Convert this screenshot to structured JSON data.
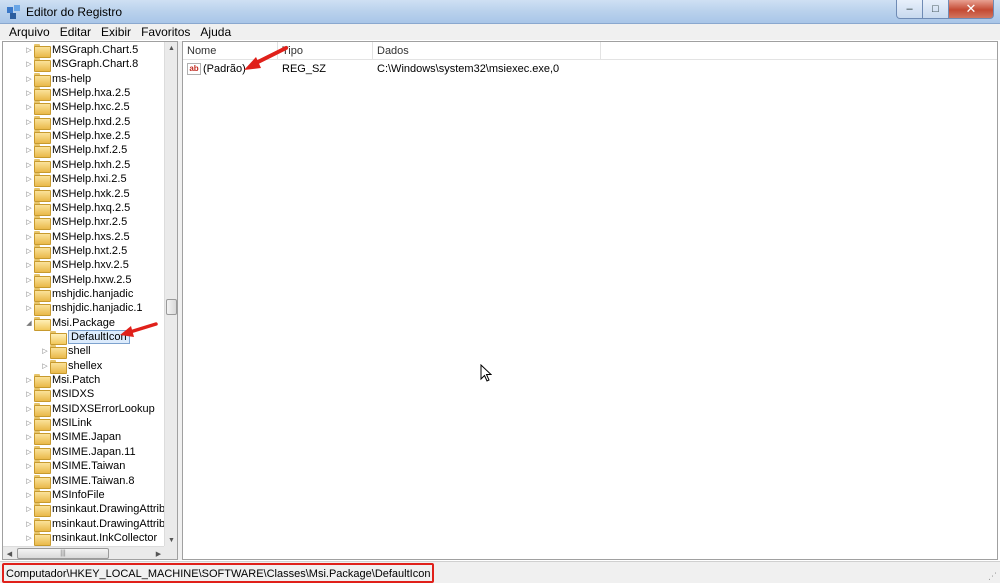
{
  "window": {
    "title": "Editor do Registro",
    "minimize_glyph": "–",
    "maximize_glyph": "□",
    "close_glyph": "✕"
  },
  "menu": [
    "Arquivo",
    "Editar",
    "Exibir",
    "Favoritos",
    "Ajuda"
  ],
  "tree": {
    "items": [
      {
        "label": "MSGraph.Chart.5",
        "level": 0,
        "expander": "collapsed"
      },
      {
        "label": "MSGraph.Chart.8",
        "level": 0,
        "expander": "collapsed"
      },
      {
        "label": "ms-help",
        "level": 0,
        "expander": "collapsed"
      },
      {
        "label": "MSHelp.hxa.2.5",
        "level": 0,
        "expander": "collapsed"
      },
      {
        "label": "MSHelp.hxc.2.5",
        "level": 0,
        "expander": "collapsed"
      },
      {
        "label": "MSHelp.hxd.2.5",
        "level": 0,
        "expander": "collapsed"
      },
      {
        "label": "MSHelp.hxe.2.5",
        "level": 0,
        "expander": "collapsed"
      },
      {
        "label": "MSHelp.hxf.2.5",
        "level": 0,
        "expander": "collapsed"
      },
      {
        "label": "MSHelp.hxh.2.5",
        "level": 0,
        "expander": "collapsed"
      },
      {
        "label": "MSHelp.hxi.2.5",
        "level": 0,
        "expander": "collapsed"
      },
      {
        "label": "MSHelp.hxk.2.5",
        "level": 0,
        "expander": "collapsed"
      },
      {
        "label": "MSHelp.hxq.2.5",
        "level": 0,
        "expander": "collapsed"
      },
      {
        "label": "MSHelp.hxr.2.5",
        "level": 0,
        "expander": "collapsed"
      },
      {
        "label": "MSHelp.hxs.2.5",
        "level": 0,
        "expander": "collapsed"
      },
      {
        "label": "MSHelp.hxt.2.5",
        "level": 0,
        "expander": "collapsed"
      },
      {
        "label": "MSHelp.hxv.2.5",
        "level": 0,
        "expander": "collapsed"
      },
      {
        "label": "MSHelp.hxw.2.5",
        "level": 0,
        "expander": "collapsed"
      },
      {
        "label": "mshjdic.hanjadic",
        "level": 0,
        "expander": "collapsed"
      },
      {
        "label": "mshjdic.hanjadic.1",
        "level": 0,
        "expander": "collapsed"
      },
      {
        "label": "Msi.Package",
        "level": 0,
        "expander": "expanded"
      },
      {
        "label": "DefaultIcon",
        "level": 1,
        "expander": "none",
        "selected": true
      },
      {
        "label": "shell",
        "level": 1,
        "expander": "collapsed"
      },
      {
        "label": "shellex",
        "level": 1,
        "expander": "collapsed"
      },
      {
        "label": "Msi.Patch",
        "level": 0,
        "expander": "collapsed"
      },
      {
        "label": "MSIDXS",
        "level": 0,
        "expander": "collapsed"
      },
      {
        "label": "MSIDXSErrorLookup",
        "level": 0,
        "expander": "collapsed"
      },
      {
        "label": "MSILink",
        "level": 0,
        "expander": "collapsed"
      },
      {
        "label": "MSIME.Japan",
        "level": 0,
        "expander": "collapsed"
      },
      {
        "label": "MSIME.Japan.11",
        "level": 0,
        "expander": "collapsed"
      },
      {
        "label": "MSIME.Taiwan",
        "level": 0,
        "expander": "collapsed"
      },
      {
        "label": "MSIME.Taiwan.8",
        "level": 0,
        "expander": "collapsed"
      },
      {
        "label": "MSInfoFile",
        "level": 0,
        "expander": "collapsed"
      },
      {
        "label": "msinkaut.DrawingAttribut",
        "level": 0,
        "expander": "collapsed"
      },
      {
        "label": "msinkaut.DrawingAttribut",
        "level": 0,
        "expander": "collapsed"
      },
      {
        "label": "msinkaut.InkCollector",
        "level": 0,
        "expander": "collapsed"
      }
    ],
    "scroll_up_glyph": "▲",
    "scroll_down_glyph": "▼",
    "scroll_left_glyph": "◀",
    "scroll_right_glyph": "▶",
    "hthumb_grip": "|||"
  },
  "list": {
    "columns": [
      "Nome",
      "Tipo",
      "Dados"
    ],
    "rows": [
      {
        "name": "(Padrão)",
        "type": "REG_SZ",
        "data": "C:\\Windows\\system32\\msiexec.exe,0",
        "icon": "string-value-icon",
        "icon_text": "ab"
      }
    ]
  },
  "statusbar": {
    "path": "Computador\\HKEY_LOCAL_MACHINE\\SOFTWARE\\Classes\\Msi.Package\\DefaultIcon",
    "grip": "⋰"
  },
  "colors": {
    "annotation_red": "#e0201a",
    "selection_bg": "#dcebfc",
    "selection_border": "#7da2ce"
  }
}
